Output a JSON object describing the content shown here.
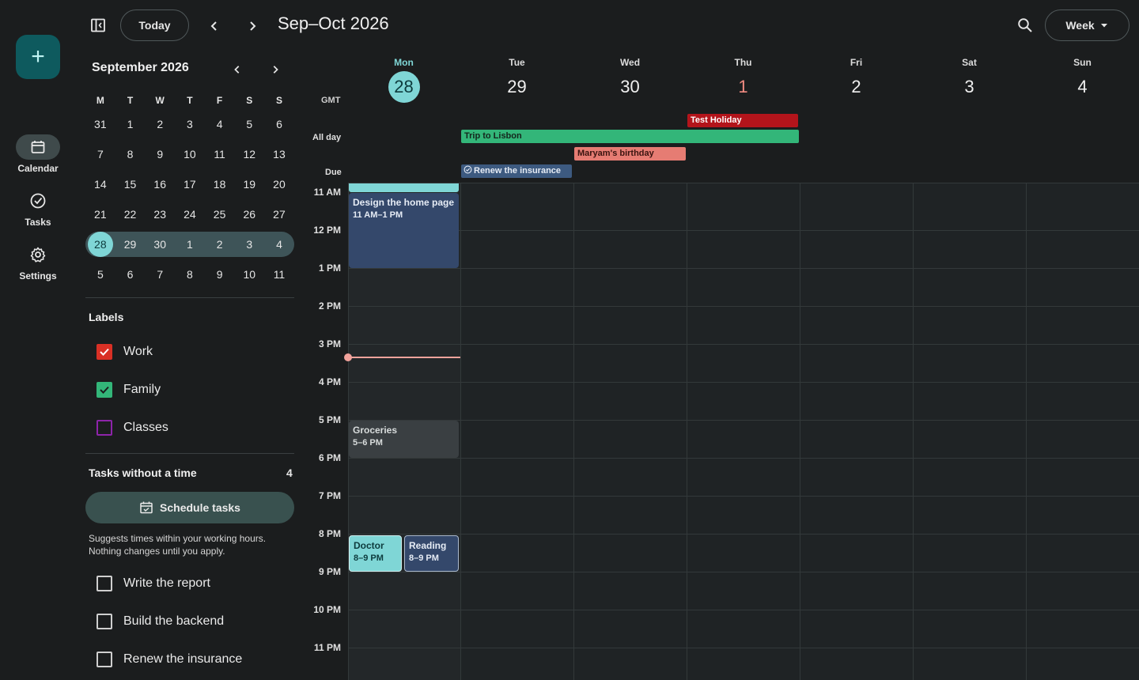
{
  "rail": {
    "create_label": "+",
    "items": [
      {
        "label": "Calendar",
        "icon": "calendar-icon",
        "active": true
      },
      {
        "label": "Tasks",
        "icon": "tasks-check-icon",
        "active": false
      },
      {
        "label": "Settings",
        "icon": "gear-icon",
        "active": false
      }
    ]
  },
  "toolbar": {
    "today_label": "Today",
    "range_title": "Sep–Oct 2026",
    "view_label": "Week"
  },
  "mini_calendar": {
    "title": "September 2026",
    "dow": [
      "M",
      "T",
      "W",
      "T",
      "F",
      "S",
      "S"
    ],
    "weeks": [
      [
        "31",
        "1",
        "2",
        "3",
        "4",
        "5",
        "6"
      ],
      [
        "7",
        "8",
        "9",
        "10",
        "11",
        "12",
        "13"
      ],
      [
        "14",
        "15",
        "16",
        "17",
        "18",
        "19",
        "20"
      ],
      [
        "21",
        "22",
        "23",
        "24",
        "25",
        "26",
        "27"
      ],
      [
        "28",
        "29",
        "30",
        "1",
        "2",
        "3",
        "4"
      ],
      [
        "5",
        "6",
        "7",
        "8",
        "9",
        "10",
        "11"
      ]
    ]
  },
  "labels": {
    "title": "Labels",
    "items": [
      {
        "name": "Work",
        "color": "#d93025",
        "checked": true
      },
      {
        "name": "Family",
        "color": "#33b679",
        "checked": true
      },
      {
        "name": "Classes",
        "color": "#8e24aa",
        "checked": false
      }
    ]
  },
  "tasks": {
    "title": "Tasks without a time",
    "count": "4",
    "schedule_label": "Schedule tasks",
    "hint": "Suggests times within your working hours. Nothing changes until you apply.",
    "items": [
      "Write the report",
      "Build the backend",
      "Renew the insurance"
    ]
  },
  "week": {
    "timezone": "GMT",
    "allday_label": "All day",
    "due_label": "Due",
    "days": [
      {
        "name": "Mon",
        "num": "28"
      },
      {
        "name": "Tue",
        "num": "29"
      },
      {
        "name": "Wed",
        "num": "30"
      },
      {
        "name": "Thu",
        "num": "1"
      },
      {
        "name": "Fri",
        "num": "2"
      },
      {
        "name": "Sat",
        "num": "3"
      },
      {
        "name": "Sun",
        "num": "4"
      }
    ],
    "hours": [
      "11 AM",
      "12 PM",
      "1 PM",
      "2 PM",
      "3 PM",
      "4 PM",
      "5 PM",
      "6 PM",
      "7 PM",
      "8 PM",
      "9 PM",
      "10 PM",
      "11 PM"
    ]
  },
  "allday_events": {
    "holiday": {
      "title": "Test Holiday",
      "color": "#b3141b"
    },
    "trip": {
      "title": "Trip to Lisbon",
      "color": "#33b679"
    },
    "birthday": {
      "title": "Maryam's birthday",
      "color": "#e67c73"
    },
    "due": {
      "title": "Renew the insurance",
      "color": "#3d5a80"
    }
  },
  "events": {
    "design": {
      "title": "Design the home page",
      "time": "11 AM–1 PM",
      "color": "#34486b"
    },
    "groceries": {
      "title": "Groceries",
      "time": "5–6 PM",
      "color": "#3a3f42"
    },
    "doctor": {
      "title": "Doctor",
      "time": "8–9 PM",
      "color": "#7fd6d6"
    },
    "reading": {
      "title": "Reading",
      "time": "8–9 PM",
      "color": "#34486b"
    }
  }
}
